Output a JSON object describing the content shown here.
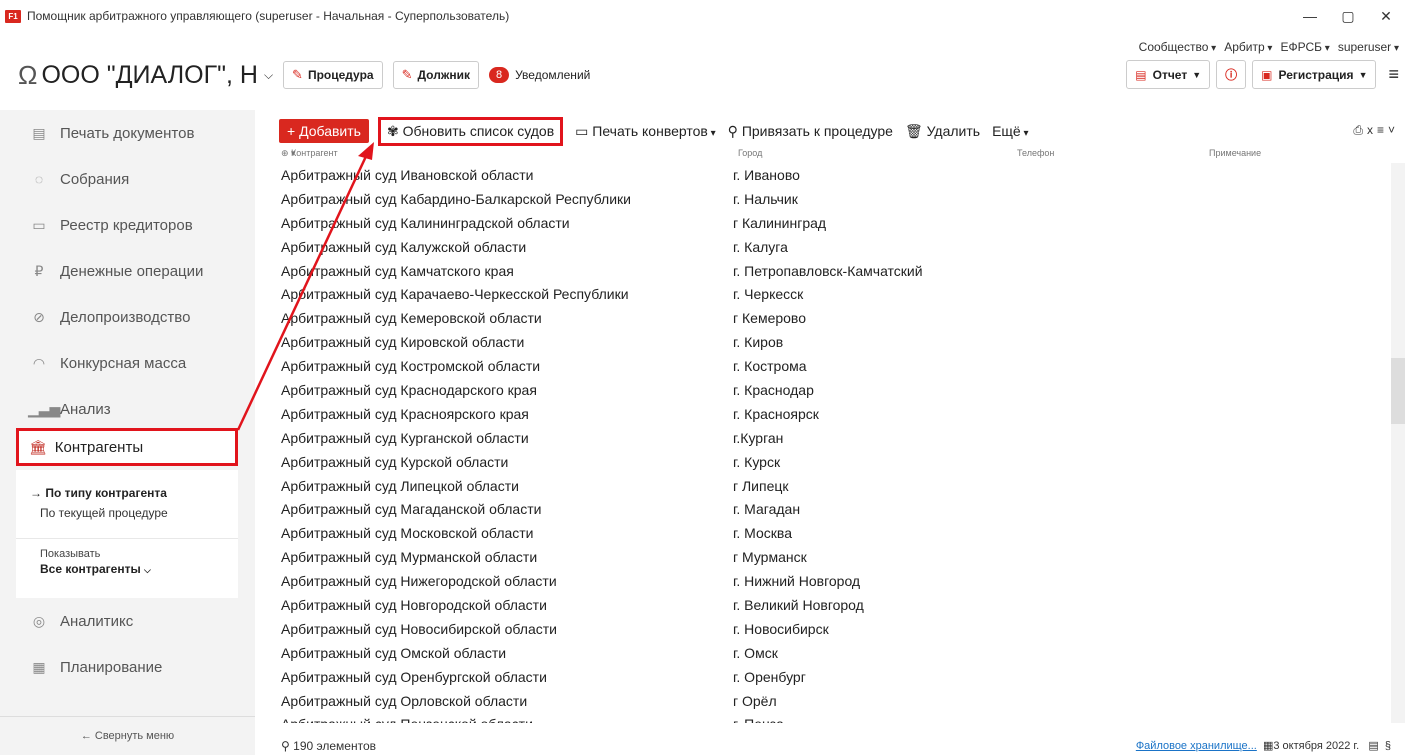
{
  "window": {
    "logo": "F1",
    "title": "Помощник арбитражного управляющего (superuser - Начальная - Суперпользователь)",
    "minimize": "—",
    "maximize": "▢",
    "close": "✕"
  },
  "topnav": [
    "Сообщество",
    "Арбитр",
    "ЕФРСБ",
    "superuser"
  ],
  "header": {
    "org_title": "ООО \"ДИАЛОГ\", Н",
    "procedure_btn": "Процедура",
    "debtor_btn": "Должник",
    "notif_count": "8",
    "notif_label": "Уведомлений",
    "report_btn": "Отчет",
    "registration_btn": "Регистрация"
  },
  "sidebar": {
    "items": [
      {
        "label": "Печать документов",
        "icon": "document-icon"
      },
      {
        "label": "Собрания",
        "icon": "meeting-icon"
      },
      {
        "label": "Реестр кредиторов",
        "icon": "registry-icon"
      },
      {
        "label": "Денежные операции",
        "icon": "ruble-icon"
      },
      {
        "label": "Делопроизводство",
        "icon": "paperclip-icon"
      },
      {
        "label": "Конкурсная масса",
        "icon": "mass-icon"
      },
      {
        "label": "Анализ",
        "icon": "chart-icon"
      }
    ],
    "active": "Контрагенты",
    "sub": {
      "by_type": "→ По типу контрагента",
      "by_procedure": "По текущей процедуре",
      "show_label": "Показывать",
      "show_value": "Все контрагенты"
    },
    "items_bottom": [
      {
        "label": "Аналитикс",
        "icon": "analytics-icon"
      },
      {
        "label": "Планирование",
        "icon": "calendar-icon"
      }
    ],
    "collapse": "← Свернуть меню"
  },
  "toolbar": {
    "add": "+ Добавить",
    "refresh": "Обновить список судов",
    "print_env": "Печать конвертов",
    "attach": "Привязать к процедуре",
    "delete": "Удалить",
    "more": "Ещё"
  },
  "columns": {
    "counterparty": "Контрагент",
    "city": "Город",
    "phone": "Телефон",
    "note": "Примечание"
  },
  "rows": [
    [
      "Арбитражный суд Ивановской области",
      "г. Иваново"
    ],
    [
      "Арбитражный суд Кабардино-Балкарской Республики",
      "г. Нальчик"
    ],
    [
      "Арбитражный суд Калининградской области",
      "г Калининград"
    ],
    [
      "Арбитражный суд Калужской области",
      "г. Калуга"
    ],
    [
      "Арбитражный суд Камчатского края",
      "г. Петропавловск-Камчатский"
    ],
    [
      "Арбитражный суд Карачаево-Черкесской Республики",
      "г. Черкесск"
    ],
    [
      "Арбитражный суд Кемеровской области",
      "г Кемерово"
    ],
    [
      "Арбитражный суд Кировской области",
      "г. Киров"
    ],
    [
      "Арбитражный суд Костромской области",
      "г. Кострома"
    ],
    [
      "Арбитражный суд Краснодарского края",
      "г. Краснодар"
    ],
    [
      "Арбитражный суд Красноярского края",
      "г. Красноярск"
    ],
    [
      "Арбитражный суд Курганской области",
      "г.Курган"
    ],
    [
      "Арбитражный суд Курской области",
      "г. Курск"
    ],
    [
      "Арбитражный суд Липецкой области",
      "г Липецк"
    ],
    [
      "Арбитражный суд Магаданской области",
      "г. Магадан"
    ],
    [
      "Арбитражный суд Московской области",
      "г. Москва"
    ],
    [
      "Арбитражный суд Мурманской области",
      "г Мурманск"
    ],
    [
      "Арбитражный суд Нижегородской области",
      "г. Нижний Новгород"
    ],
    [
      "Арбитражный суд Новгородской области",
      "г. Великий Новгород"
    ],
    [
      "Арбитражный суд Новосибирской области",
      "г. Новосибирск"
    ],
    [
      "Арбитражный суд Омской области",
      "г. Омск"
    ],
    [
      "Арбитражный суд Оренбургской области",
      "г. Оренбург"
    ],
    [
      "Арбитражный суд Орловской области",
      "г Орёл"
    ],
    [
      "Арбитражный суд Пензенской области",
      "г. Пенза"
    ]
  ],
  "status": {
    "count": "190 элементов",
    "storage_link": "Файловое хранилище...",
    "date": "3 октября 2022 г."
  },
  "colors": {
    "accent": "#d9281f",
    "highlight": "#e1141c",
    "sidebar_bg": "#f3f3f3"
  }
}
